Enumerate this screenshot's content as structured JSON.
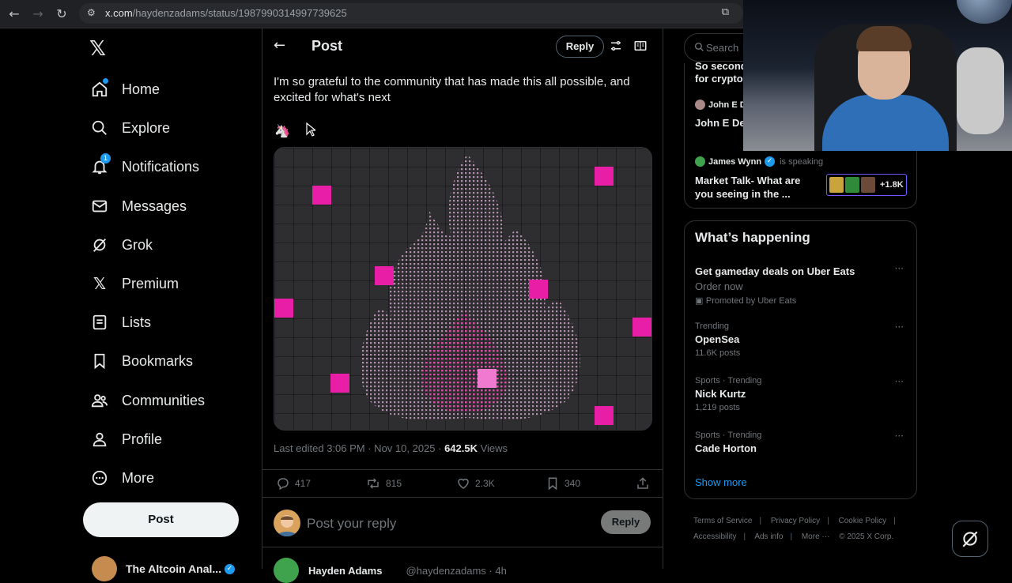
{
  "browser": {
    "url_host": "x.com",
    "url_path": "/haydenzadams/status/1987990314997739625"
  },
  "nav": {
    "items": [
      {
        "label": "Home",
        "icon": "home-icon"
      },
      {
        "label": "Explore",
        "icon": "search-icon"
      },
      {
        "label": "Notifications",
        "icon": "bell-icon",
        "badge": "1"
      },
      {
        "label": "Messages",
        "icon": "envelope-icon"
      },
      {
        "label": "Grok",
        "icon": "grok-icon"
      },
      {
        "label": "Premium",
        "icon": "x-logo-icon"
      },
      {
        "label": "Lists",
        "icon": "list-icon"
      },
      {
        "label": "Bookmarks",
        "icon": "bookmark-icon"
      },
      {
        "label": "Communities",
        "icon": "people-icon"
      },
      {
        "label": "Profile",
        "icon": "person-icon"
      },
      {
        "label": "More",
        "icon": "more-circle-icon"
      }
    ],
    "post_button": "Post",
    "account_name": "The Altcoin Anal..."
  },
  "header": {
    "title": "Post",
    "reply_button": "Reply"
  },
  "post": {
    "text": "I'm so grateful to the community that has made this all possible, and excited for what's next",
    "emoji": "🦄",
    "edited_label": "Last edited 3:06 PM · Nov 10, 2025 · ",
    "views_count": "642.5K",
    "views_label": " Views",
    "replies": "417",
    "reposts": "815",
    "likes": "2.3K",
    "bookmarks": "340"
  },
  "composer": {
    "placeholder": "Post your reply",
    "reply_button": "Reply"
  },
  "next_reply": {
    "name": "Hayden Adams",
    "handle": "@haydenzadams · 4h"
  },
  "search": {
    "placeholder": "Search"
  },
  "spaces": {
    "partial_title": "So second",
    "partial_title_2": "for crypto",
    "host2_name": "John E D",
    "host2_title": "John E Dea",
    "host3_name": "James Wynn",
    "host3_status": "is speaking",
    "host3_title": "Market Talk-  What are you seeing in the ...",
    "listeners": "+1.8K"
  },
  "whats_happening": {
    "title": "What’s happening",
    "trends": [
      {
        "context": "",
        "title": "Get gameday deals on Uber Eats",
        "sub": "Order now",
        "count": "Promoted by Uber Eats"
      },
      {
        "context": "Trending",
        "title": "OpenSea",
        "count": "11.6K posts"
      },
      {
        "context": "Sports · Trending",
        "title": "Nick Kurtz",
        "count": "1,219 posts"
      },
      {
        "context": "Sports · Trending",
        "title": "Cade Horton",
        "count": ""
      }
    ],
    "show_more": "Show more"
  },
  "footer": {
    "links": [
      "Terms of Service",
      "Privacy Policy",
      "Cookie Policy",
      "Accessibility",
      "Ads info",
      "More ···",
      "© 2025 X Corp."
    ]
  },
  "colors": {
    "accent": "#1d9bf0",
    "magenta": "#e91ea6",
    "background": "#000000"
  }
}
